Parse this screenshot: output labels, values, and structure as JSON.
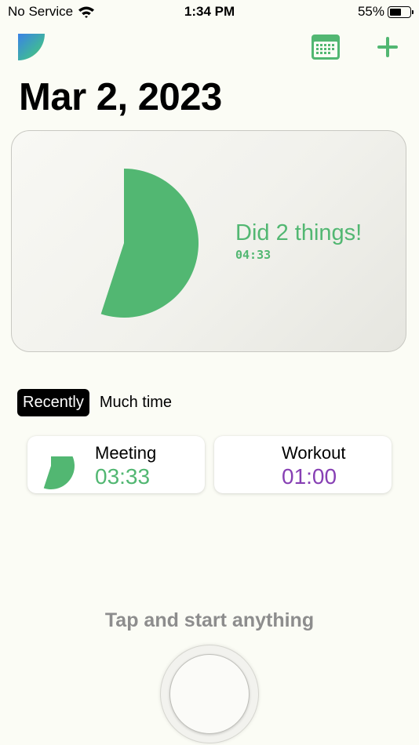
{
  "status_bar": {
    "carrier": "No Service",
    "time": "1:34 PM",
    "battery": "55%",
    "battery_level": 0.55
  },
  "header": {
    "logo": "app-logo",
    "calendar_icon": "calendar-icon",
    "add_icon": "plus-icon",
    "title": "Mar 2, 2023"
  },
  "summary": {
    "headline": "Did 2 things!",
    "duration": "04:33"
  },
  "chart_data": {
    "type": "pie",
    "segments": [
      {
        "label": "Meeting",
        "value": 213,
        "color": "#52b772"
      },
      {
        "label": "Workout",
        "value": 60,
        "color": "#8740b4"
      }
    ]
  },
  "tabs": [
    {
      "label": "Recently",
      "active": true
    },
    {
      "label": "Much time",
      "active": false
    }
  ],
  "activities": [
    {
      "name": "Meeting",
      "time": "03:33",
      "color": "#52b772"
    },
    {
      "name": "Workout",
      "time": "01:00",
      "color": "#8740b4"
    }
  ],
  "start": {
    "prompt": "Tap and start anything"
  }
}
